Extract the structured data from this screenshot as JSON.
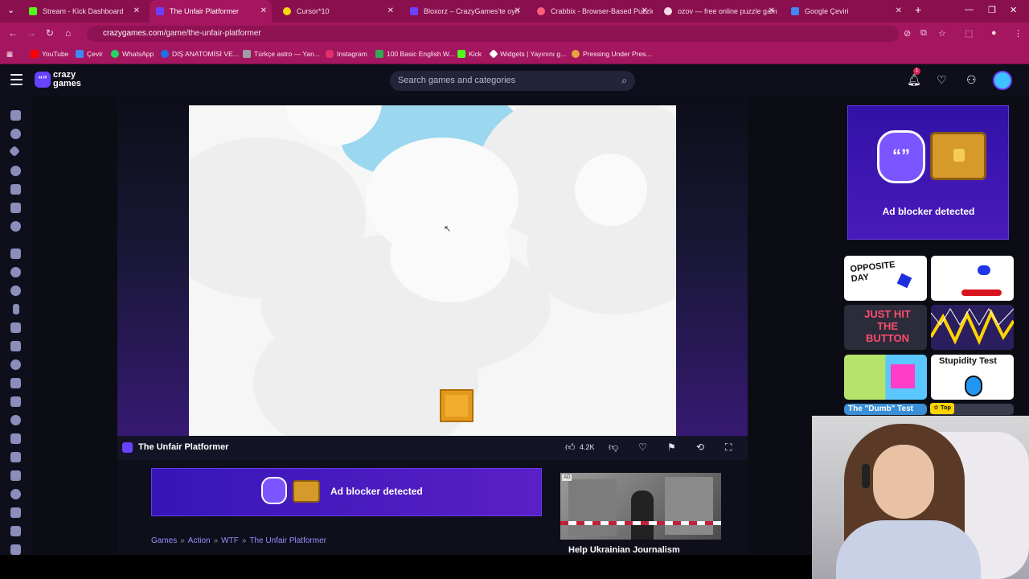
{
  "browser": {
    "tabs": [
      {
        "title": "Stream - Kick Dashboard",
        "favicon_color": "#53fc18",
        "active": false
      },
      {
        "title": "The Unfair Platformer",
        "favicon_color": "#6842ff",
        "active": true
      },
      {
        "title": "Cursor*10",
        "favicon_color": "#f5d90a",
        "active": false
      },
      {
        "title": "Bloxorz – CrazyGames'te oyn",
        "favicon_color": "#6842ff",
        "active": false
      },
      {
        "title": "Crabbix - Browser-Based Puzzle",
        "favicon_color": "#ff5f7a",
        "active": false
      },
      {
        "title": "ozov — free online puzzle gam",
        "favicon_color": "#f3dbe6",
        "active": false
      },
      {
        "title": "Google Çeviri",
        "favicon_color": "#4285f4",
        "active": false
      }
    ],
    "new_tab_label": "+",
    "url": {
      "host": "crazygames.com",
      "path": "/game/the-unfair-platformer"
    },
    "bookmarks": [
      {
        "label": "YouTube",
        "color": "#ff0000"
      },
      {
        "label": "Çevir",
        "color": "#4285f4"
      },
      {
        "label": "WhatsApp",
        "color": "#25d366"
      },
      {
        "label": "DIŞ ANATOMİSİ VE...",
        "color": "#1a73e8"
      },
      {
        "label": "Türkçe astro — Yan...",
        "color": "#9aa0a6"
      },
      {
        "label": "Instagram",
        "color": "#e1306c"
      },
      {
        "label": "100 Basic English W...",
        "color": "#34a853"
      },
      {
        "label": "Kick",
        "color": "#53fc18"
      },
      {
        "label": "Widgets | Yayınını g...",
        "color": "#ffffff"
      },
      {
        "label": "Pressing Under Pres...",
        "color": "#e8a33a"
      }
    ]
  },
  "site": {
    "logo_line1": "crazy",
    "logo_line2": "games",
    "search_placeholder": "Search games and categories",
    "notification_count": "1"
  },
  "game": {
    "title": "The Unfair Platformer",
    "likes": "4.2K"
  },
  "ads": {
    "adblock_text": "Ad blocker detected",
    "ad_tag": "AD",
    "ad_caption": "Help Ukrainian Journalism"
  },
  "breadcrumb": [
    "Games",
    "Action",
    "WTF",
    "The Unfair Platformer"
  ],
  "recommended": [
    {
      "title": "OPPOSITE DAY"
    },
    {
      "title": ""
    },
    {
      "title": "JUST HIT THE BUTTON"
    },
    {
      "title": ""
    },
    {
      "title": ""
    },
    {
      "title": "Stupidity Test"
    },
    {
      "title": "The \"Dumb\" Test"
    },
    {
      "title": ""
    }
  ],
  "badge_top": "Top"
}
